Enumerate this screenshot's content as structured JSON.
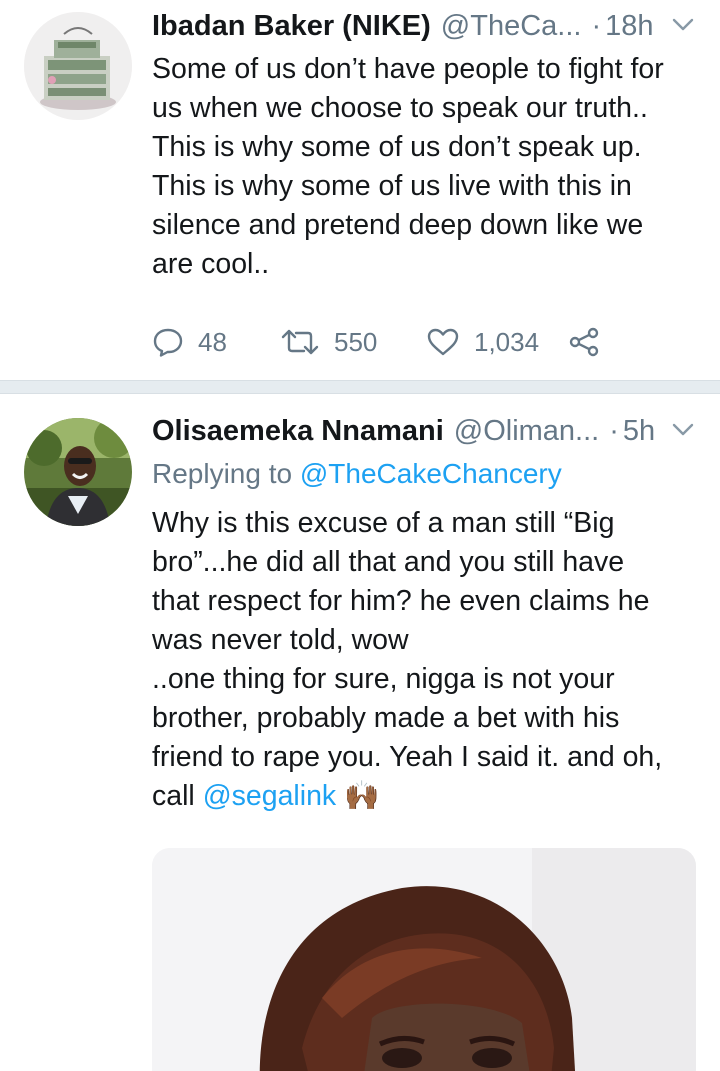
{
  "tweet1": {
    "name": "Ibadan Baker (NIKE)",
    "handle": "@TheCa...",
    "separator": "·",
    "time": "18h",
    "lines": [
      "Some of us don’t have people to fight for",
      "us when we choose to speak our truth..",
      "This is why some of us don’t speak up.",
      "This is why some of us live with this in",
      "silence and pretend deep down like we",
      "are cool.."
    ],
    "replies": "48",
    "retweets": "550",
    "likes": "1,034"
  },
  "tweet2": {
    "name": "Olisaemeka Nnamani",
    "handle": "@Oliman...",
    "separator": "·",
    "time": "5h",
    "replying_label": "Replying to",
    "replying_handle": "@TheCakeChancery",
    "lines": [
      "Why is this excuse of a man still “Big",
      "bro”...he did all that and you still have",
      "that respect for him? he even claims he",
      "was never told, wow",
      "..one thing for sure, nigga is not your",
      "brother, probably made a bet with his",
      "friend to rape you. Yeah I said it. and oh,"
    ],
    "last_line_prefix": "call",
    "mention": "@segalink",
    "emoji": "🙌🏾"
  },
  "colors": {
    "text": "#14171a",
    "secondary": "#657786",
    "link": "#1da1f2",
    "divider": "#e6ecf0"
  },
  "icons": [
    "chevron-down-icon",
    "reply-icon",
    "retweet-icon",
    "like-icon",
    "share-icon",
    "raised-hands-emoji"
  ]
}
